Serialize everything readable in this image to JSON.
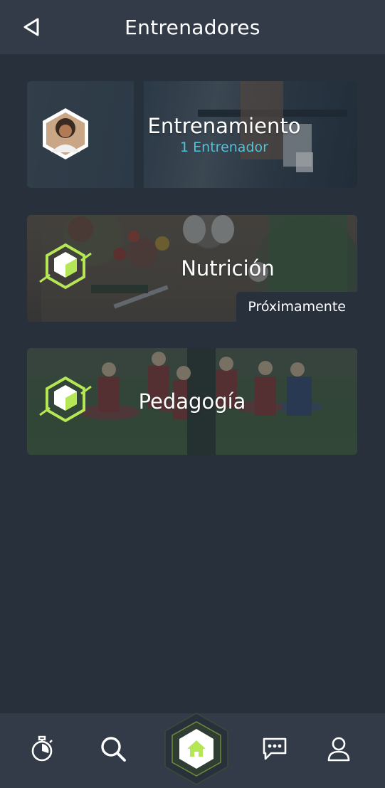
{
  "header": {
    "title": "Entrenadores",
    "back_icon": "back-arrow-icon"
  },
  "cards": [
    {
      "title": "Entrenamiento",
      "subtitle": "1 Entrenador",
      "icon": "coach-avatar",
      "accent": "#4fc3d9"
    },
    {
      "title": "Nutrición",
      "badge": "Próximamente",
      "icon": "hexagon-logo-icon"
    },
    {
      "title": "Pedagogía",
      "icon": "hexagon-logo-icon"
    }
  ],
  "bottom_nav": {
    "items": [
      {
        "icon": "stopwatch-icon"
      },
      {
        "icon": "search-icon"
      },
      {
        "icon": "home-icon",
        "active": true
      },
      {
        "icon": "chat-icon"
      },
      {
        "icon": "profile-icon"
      }
    ]
  },
  "colors": {
    "background": "#28303b",
    "header": "#323b47",
    "brand_green": "#b5e655",
    "subtitle_cyan": "#4fc3d9"
  }
}
